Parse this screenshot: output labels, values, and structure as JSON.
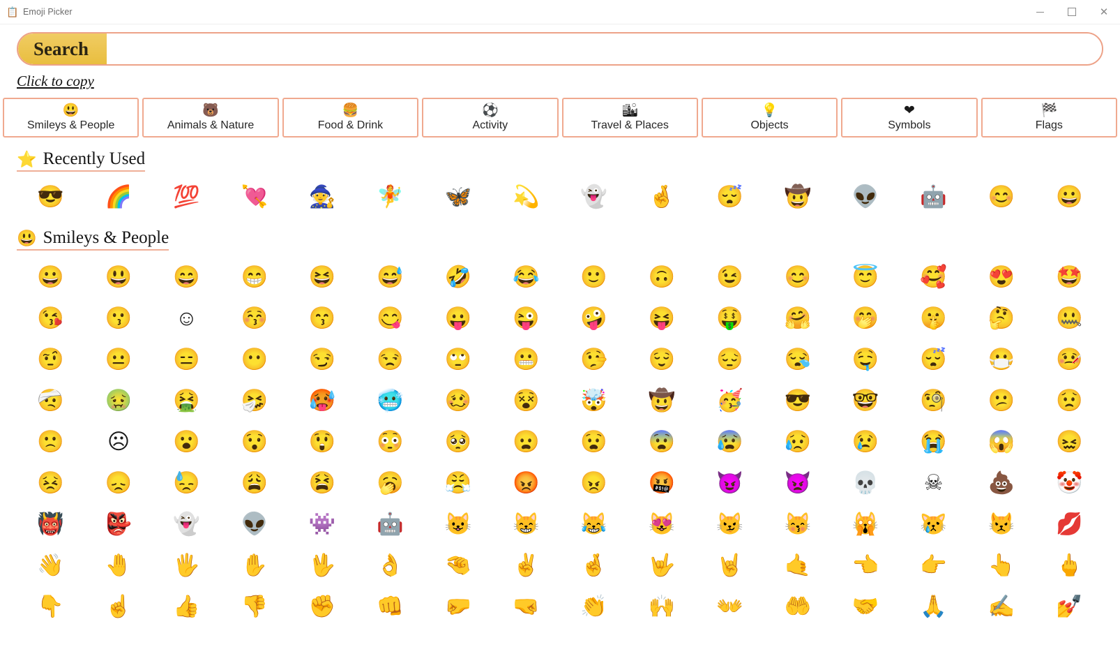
{
  "window": {
    "title": "Emoji Picker",
    "icon": "clipboard-icon",
    "minimize_label": "─",
    "maximize_label": "□",
    "close_label": "✕"
  },
  "search": {
    "label": "Search",
    "value": "",
    "placeholder": ""
  },
  "hint": {
    "click_to_copy": "Click to copy"
  },
  "colors": {
    "accent_border": "#F0A98F",
    "search_label_bg": "#EFC95A",
    "section_underline": "#EFAF97",
    "title_text": "#6B6B6B",
    "page_bg": "#FFFFFF"
  },
  "tabs": [
    {
      "label": "Smileys & People",
      "emoji": "😃",
      "icon": "smiley-face-icon"
    },
    {
      "label": "Animals & Nature",
      "emoji": "🐻",
      "icon": "bear-face-icon"
    },
    {
      "label": "Food & Drink",
      "emoji": "🍔",
      "icon": "hamburger-icon"
    },
    {
      "label": "Activity",
      "emoji": "⚽",
      "icon": "soccer-ball-icon"
    },
    {
      "label": "Travel & Places",
      "emoji": "🏙",
      "icon": "cityscape-icon"
    },
    {
      "label": "Objects",
      "emoji": "💡",
      "icon": "light-bulb-icon"
    },
    {
      "label": "Symbols",
      "emoji": "❤",
      "icon": "red-heart-icon"
    },
    {
      "label": "Flags",
      "emoji": "🏁",
      "icon": "chequered-flag-icon"
    }
  ],
  "sections": [
    {
      "id": "recently-used",
      "title": "Recently Used",
      "icon_emoji": "⭐",
      "icon_name": "star-icon",
      "emojis": [
        "😎",
        "🌈",
        "💯",
        "💘",
        "🧙",
        "🧚",
        "🦋",
        "💫",
        "👻",
        "🤞",
        "😴",
        "🤠",
        "👽",
        "🤖",
        "😊",
        "😀"
      ]
    },
    {
      "id": "smileys-and-people",
      "title": "Smileys & People",
      "icon_emoji": "😃",
      "icon_name": "smiley-face-icon",
      "emojis": [
        "😀",
        "😃",
        "😄",
        "😁",
        "😆",
        "😅",
        "🤣",
        "😂",
        "🙂",
        "🙃",
        "😉",
        "😊",
        "😇",
        "🥰",
        "😍",
        "🤩",
        "😘",
        "😗",
        "☺",
        "😚",
        "😙",
        "😋",
        "😛",
        "😜",
        "🤪",
        "😝",
        "🤑",
        "🤗",
        "🤭",
        "🤫",
        "🤔",
        "🤐",
        "🤨",
        "😐",
        "😑",
        "😶",
        "😏",
        "😒",
        "🙄",
        "😬",
        "🤥",
        "😌",
        "😔",
        "😪",
        "🤤",
        "😴",
        "😷",
        "🤒",
        "🤕",
        "🤢",
        "🤮",
        "🤧",
        "🥵",
        "🥶",
        "🥴",
        "😵",
        "🤯",
        "🤠",
        "🥳",
        "😎",
        "🤓",
        "🧐",
        "😕",
        "😟",
        "🙁",
        "☹",
        "😮",
        "😯",
        "😲",
        "😳",
        "🥺",
        "😦",
        "😧",
        "😨",
        "😰",
        "😥",
        "😢",
        "😭",
        "😱",
        "😖",
        "😣",
        "😞",
        "😓",
        "😩",
        "😫",
        "🥱",
        "😤",
        "😡",
        "😠",
        "🤬",
        "😈",
        "👿",
        "💀",
        "☠",
        "💩",
        "🤡",
        "👹",
        "👺",
        "👻",
        "👽",
        "👾",
        "🤖",
        "😺",
        "😸",
        "😹",
        "😻",
        "😼",
        "😽",
        "🙀",
        "😿",
        "😾",
        "💋",
        "👋",
        "🤚",
        "🖐",
        "✋",
        "🖖",
        "👌",
        "🤏",
        "✌",
        "🤞",
        "🤟",
        "🤘",
        "🤙",
        "👈",
        "👉",
        "👆",
        "🖕",
        "👇",
        "☝",
        "👍",
        "👎",
        "✊",
        "👊",
        "🤛",
        "🤜",
        "👏",
        "🙌",
        "👐",
        "🤲",
        "🤝",
        "🙏",
        "✍",
        "💅"
      ]
    }
  ]
}
